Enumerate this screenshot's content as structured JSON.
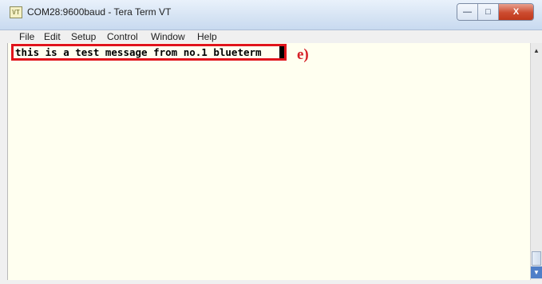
{
  "window": {
    "title": "COM28:9600baud - Tera Term VT",
    "app_icon_text": "VT",
    "controls": {
      "minimize": "—",
      "maximize": "□",
      "close": "X"
    }
  },
  "menu": {
    "items": [
      "File",
      "Edit",
      "Setup",
      "Control",
      "Window",
      "Help"
    ]
  },
  "terminal": {
    "line1": "this is a test message from no.1 blueterm"
  },
  "annotation": {
    "label": "e)",
    "color": "#d62028"
  },
  "scrollbar": {
    "up_arrow": "▲",
    "down_arrow": "▼"
  }
}
